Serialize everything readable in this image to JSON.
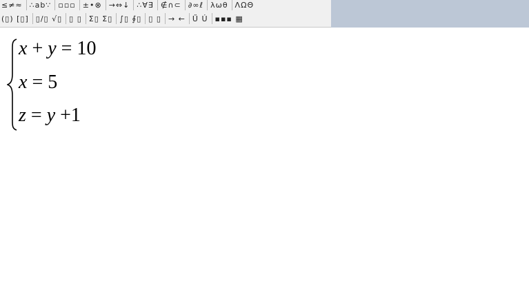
{
  "toolbar": {
    "row1": [
      "≤≠≈",
      "∴ab∵",
      "▫▫▫",
      "±•⊗",
      "→⇔↓",
      "∴∀∃",
      "∉∩⊂",
      "∂∞ℓ",
      "λωθ",
      "ΛΩΘ"
    ],
    "row2": [
      "(▯) [▯]",
      "▯/▯ √▯",
      "▯ ▯",
      "Σ▯ Σ▯",
      "∫▯ ∮▯",
      "▯ ▯",
      "→ ←",
      "Ű Ú",
      "▪▪▪ ▦"
    ]
  },
  "equations": [
    {
      "parts": [
        "x",
        " + ",
        "y",
        " = 10"
      ]
    },
    {
      "parts": [
        "x",
        " = 5"
      ]
    },
    {
      "parts": [
        "z",
        " = ",
        "y",
        " +1"
      ]
    }
  ],
  "colors": {
    "toolbar": "#f0f0f0",
    "toolbar_right": "#bcc7d6",
    "document": "#ffffff"
  }
}
